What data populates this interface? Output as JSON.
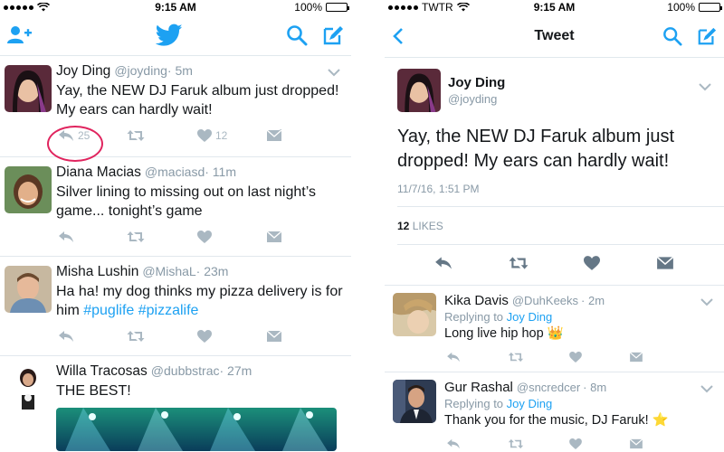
{
  "left": {
    "status": {
      "time": "9:15 AM",
      "battery": "100%",
      "battery_fill": 1.0
    },
    "tweets": [
      {
        "name": "Joy Ding",
        "handle": "@joyding",
        "time": "· 5m",
        "text": "Yay, the NEW DJ Faruk album just dropped! My ears can hardly wait!",
        "reply_count": "25",
        "like_count": "12"
      },
      {
        "name": "Diana Macias",
        "handle": "@maciasd",
        "time": "· 11m",
        "text": "Silver lining to missing out on last night’s game... tonight’s game"
      },
      {
        "name": "Misha Lushin",
        "handle": "@MishaL",
        "time": "· 23m",
        "text_plain": "Ha ha! my dog thinks my pizza delivery is for him ",
        "hashtag1": "#puglife",
        "hashtag2": "#pizzalife"
      },
      {
        "name": "Willa Tracosas",
        "handle": "@dubbstrac",
        "time": "· 27m",
        "text": "THE BEST!"
      }
    ]
  },
  "right": {
    "status": {
      "carrier": "TWTR",
      "time": "9:15 AM",
      "battery": "100%",
      "battery_fill": 1.0
    },
    "title": "Tweet",
    "detail": {
      "name": "Joy Ding",
      "handle": "@joyding",
      "text": "Yay, the NEW DJ Faruk album just dropped! My ears can hardly wait!",
      "timestamp": "11/7/16, 1:51 PM",
      "likes_count": "12",
      "likes_label": "LIKES"
    },
    "replies": [
      {
        "name": "Kika Davis",
        "handle": "@DuhKeeks",
        "time": "· 2m",
        "replying_prefix": "Replying to",
        "replying_to": "Joy Ding",
        "text": "Long live hip hop 👑"
      },
      {
        "name": "Gur Rashal",
        "handle": "@sncredcer",
        "time": "· 8m",
        "replying_prefix": "Replying to",
        "replying_to": "Joy Ding",
        "text": "Thank you for the music, DJ Faruk! ⭐"
      }
    ]
  },
  "colors": {
    "brand": "#1da1f2",
    "gray": "#aab8c2",
    "highlight": "#e0245e"
  },
  "icons": [
    "add-user-icon",
    "twitter-bird-icon",
    "search-icon",
    "compose-icon",
    "back-icon",
    "reply-icon",
    "retweet-icon",
    "like-icon",
    "message-icon",
    "chevron-down-icon",
    "wifi-icon"
  ]
}
